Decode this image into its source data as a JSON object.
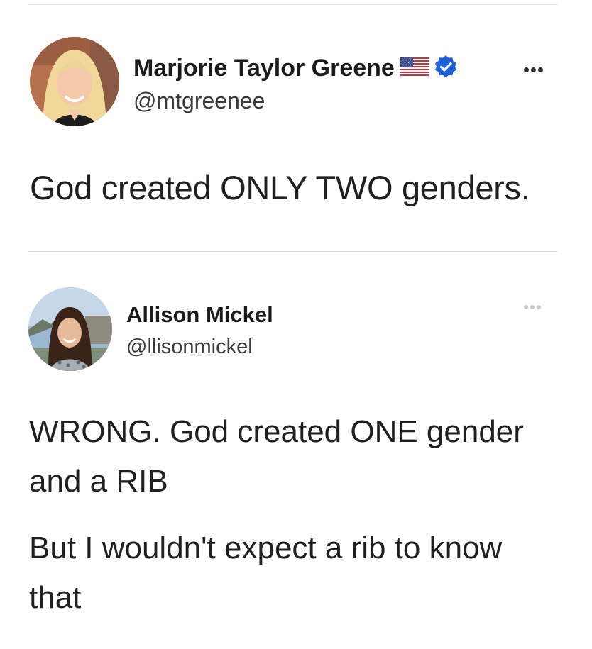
{
  "tweets": [
    {
      "author_name": "Marjorie Taylor Greene",
      "author_handle": "@mtgreenee",
      "has_flag_emoji": true,
      "verified": true,
      "text": "God created ONLY TWO genders."
    },
    {
      "author_name": "Allison Mickel",
      "author_handle": "@llisonmickel",
      "verified": false,
      "paragraphs": [
        {
          "lines": [
            "WRONG. God created ONE gender",
            "and a RIB"
          ]
        },
        {
          "lines": [
            "But I wouldn't expect a rib to know",
            "that"
          ]
        }
      ]
    }
  ],
  "colors": {
    "verified_badge": "#1d5fd6",
    "divider": "#e3e3e3",
    "more_dots_first": "#2a2a2a",
    "more_dots_second": "#c8c8c8"
  },
  "icons": {
    "flag": "us-flag-icon",
    "verified": "verified-badge-icon",
    "more": "more-options-icon"
  }
}
